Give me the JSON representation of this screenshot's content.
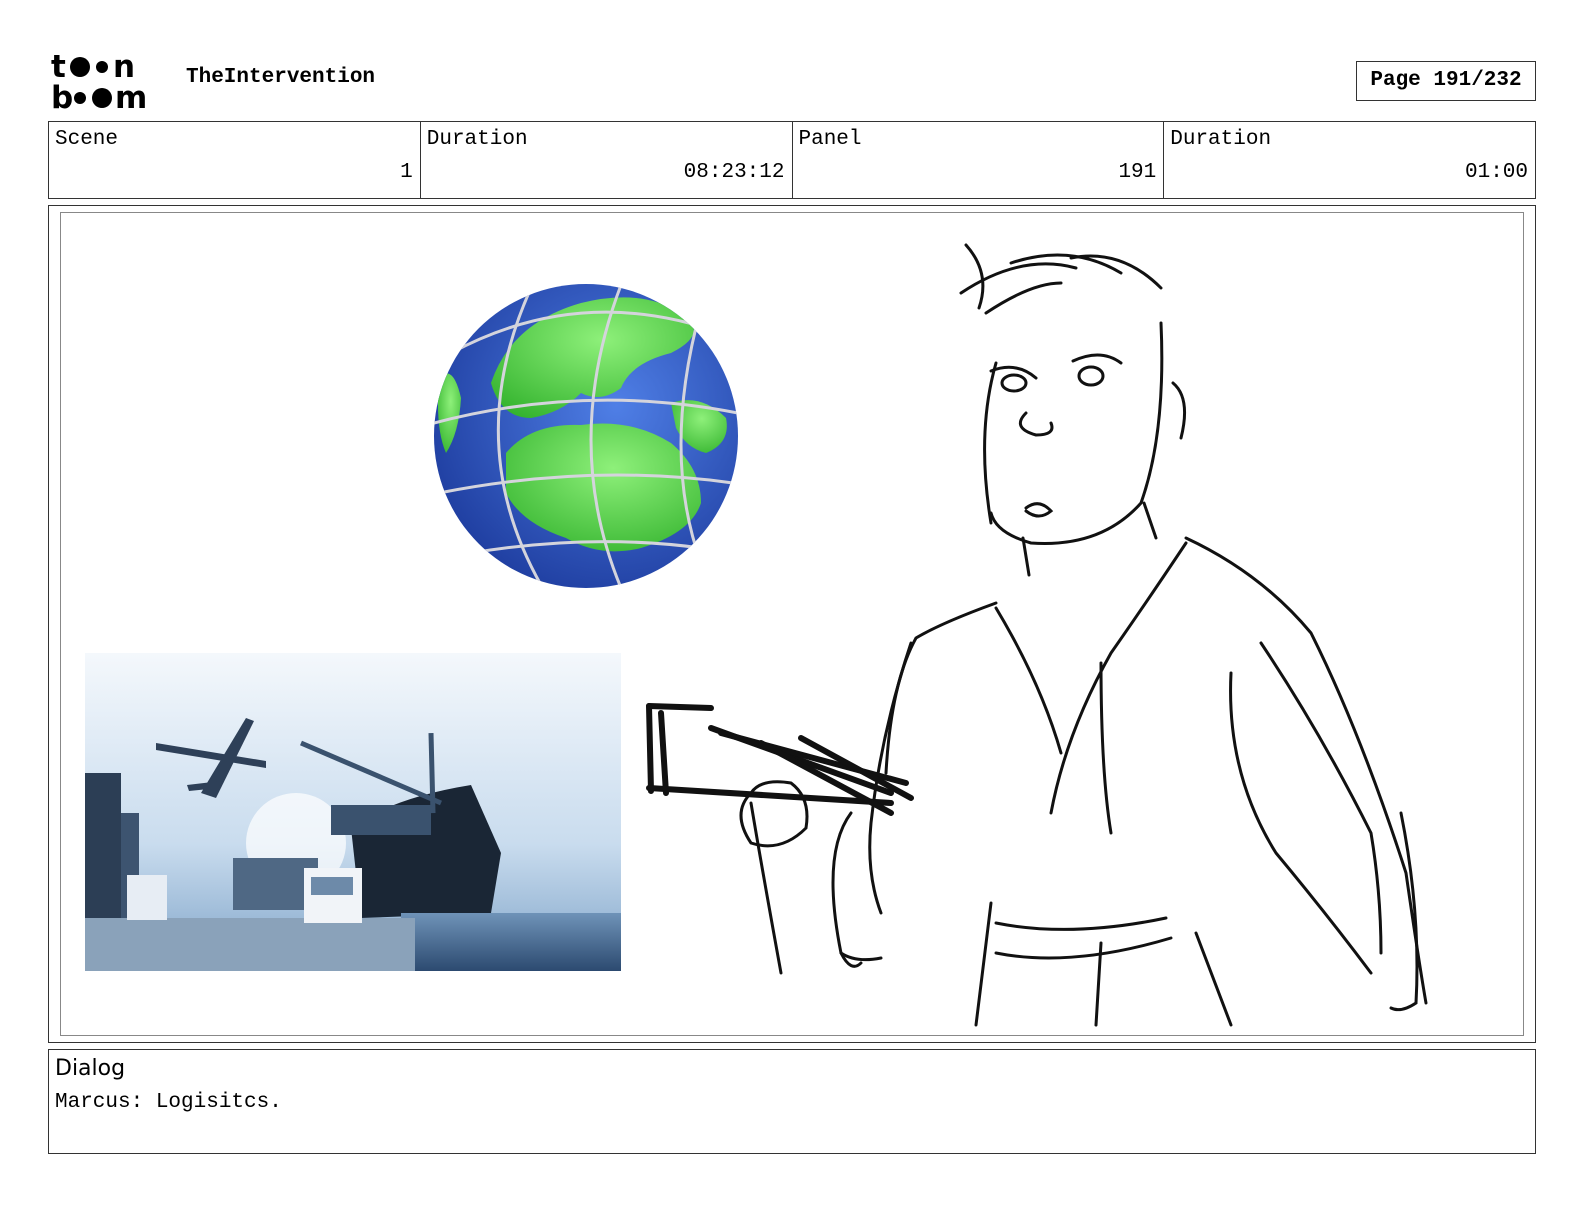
{
  "header": {
    "logo_alt": "toon boom",
    "project_title": "TheIntervention",
    "page_label": "Page 191/232"
  },
  "info": {
    "scene_label": "Scene",
    "scene_value": "1",
    "scene_duration_label": "Duration",
    "scene_duration_value": "08:23:12",
    "panel_label": "Panel",
    "panel_value": "191",
    "panel_duration_label": "Duration",
    "panel_duration_value": "01:00"
  },
  "panel": {
    "colors": {
      "ocean": "#2f56c8",
      "land": "#3fcf3a",
      "sketch": "#111111",
      "photo_sky": "#dbe7f2"
    }
  },
  "dialog": {
    "label": "Dialog",
    "text": "Marcus: Logisitcs."
  }
}
